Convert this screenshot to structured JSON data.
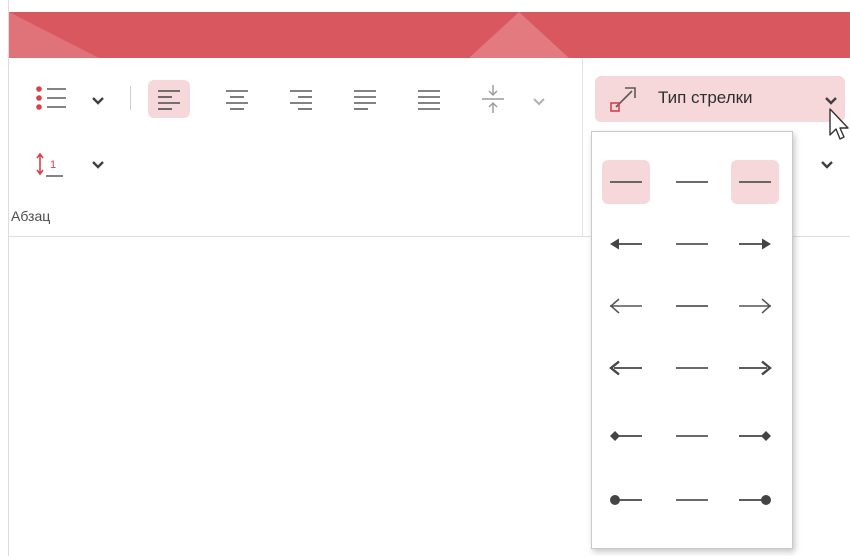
{
  "ribbon": {
    "paragraph_group_label": "Абзац",
    "arrow_type_label": "Тип стрелки"
  },
  "icons": {
    "bullets": "bullet-list-icon",
    "align_left": "align-left-icon",
    "align_center": "align-center-icon",
    "align_right": "align-right-icon",
    "justify": "justify-icon",
    "distributed": "distributed-icon",
    "vertical_align": "vertical-align-icon",
    "line_spacing": "line-spacing-icon",
    "arrow_type": "arrow-type-icon"
  },
  "dropdown": {
    "rows": [
      {
        "start": "none",
        "end": "none"
      },
      {
        "start": "triangle",
        "end": "triangle"
      },
      {
        "start": "open",
        "end": "open"
      },
      {
        "start": "stealth",
        "end": "stealth"
      },
      {
        "start": "diamond",
        "end": "diamond"
      },
      {
        "start": "oval",
        "end": "oval"
      }
    ]
  },
  "colors": {
    "titlebar": "#d9575f",
    "selected": "#f6d8db",
    "icon": "#5a5a5a",
    "accent": "#d8404a"
  }
}
